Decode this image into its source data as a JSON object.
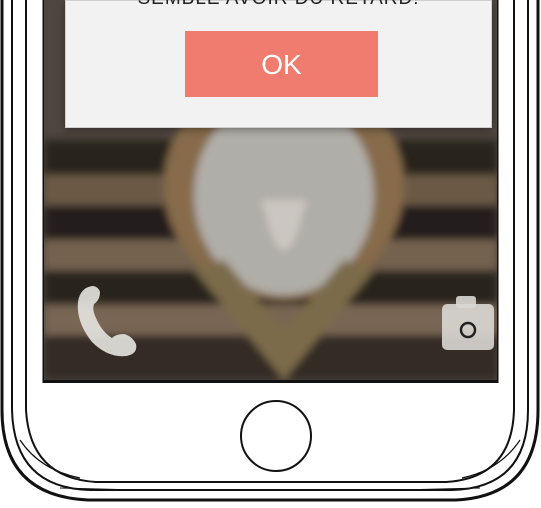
{
  "dialog": {
    "message": "SEMBLE AVOIR DU RETARD!",
    "ok_label": "OK"
  },
  "icons": {
    "call": "phone-handset-icon",
    "camera": "camera-icon",
    "home": "home-button"
  },
  "colors": {
    "ok_button": "#ef7c6e",
    "dialog_bg": "#f2f2f2",
    "outline": "#111111"
  }
}
